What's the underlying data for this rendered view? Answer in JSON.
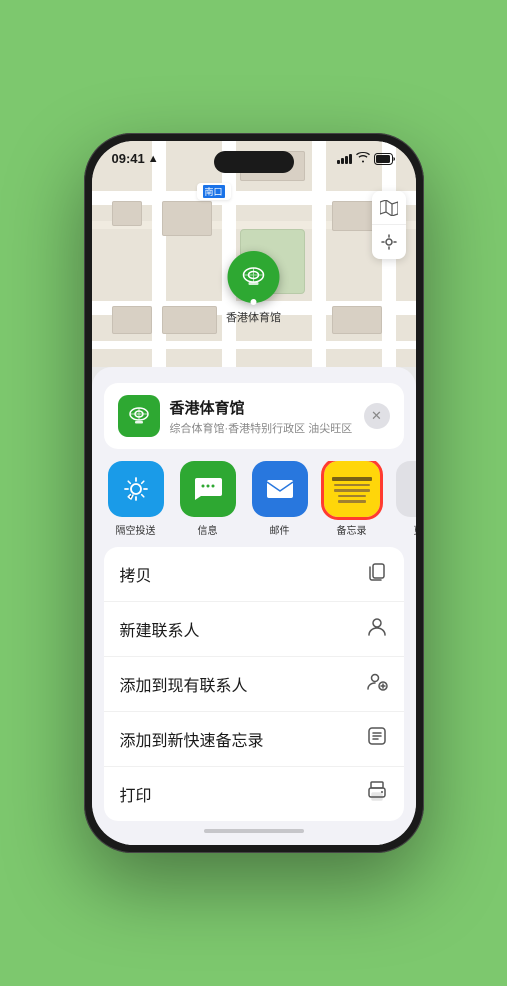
{
  "status": {
    "time": "09:41",
    "location_arrow": "▲"
  },
  "map": {
    "label_text": "南口",
    "map_icon": "🗺",
    "location_icon": "📍"
  },
  "place": {
    "name": "香港体育馆",
    "description": "综合体育馆·香港特别行政区 油尖旺区",
    "close_icon": "✕"
  },
  "apps": [
    {
      "id": "airdrop",
      "label": "隔空投送",
      "type": "airdrop"
    },
    {
      "id": "messages",
      "label": "信息",
      "type": "messages"
    },
    {
      "id": "mail",
      "label": "邮件",
      "type": "mail"
    },
    {
      "id": "notes",
      "label": "备忘录",
      "type": "notes",
      "selected": true
    },
    {
      "id": "more",
      "label": "更多",
      "type": "more"
    }
  ],
  "actions": [
    {
      "id": "copy",
      "label": "拷贝",
      "icon": "copy"
    },
    {
      "id": "new-contact",
      "label": "新建联系人",
      "icon": "person"
    },
    {
      "id": "add-contact",
      "label": "添加到现有联系人",
      "icon": "person-add"
    },
    {
      "id": "quick-note",
      "label": "添加到新快速备忘录",
      "icon": "note"
    },
    {
      "id": "print",
      "label": "打印",
      "icon": "print"
    }
  ],
  "icons": {
    "copy": "⊡",
    "person": "👤",
    "person_add": "👤",
    "note": "📝",
    "print": "🖨"
  }
}
